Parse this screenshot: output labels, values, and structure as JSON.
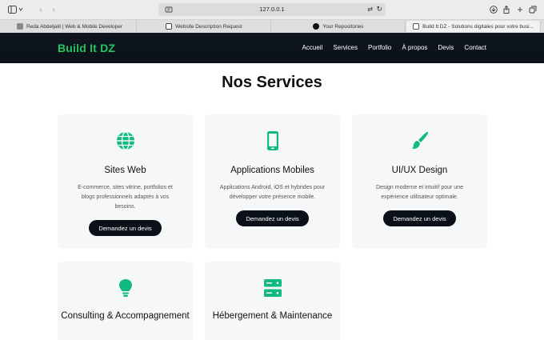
{
  "browser": {
    "url": "127.0.0.1",
    "tabs": [
      {
        "label": "Reda Abdeljalil | Web & Mobile Developer",
        "favicon_color": "#8a8a8a"
      },
      {
        "label": "Website Description Request",
        "favicon_color": "#444444"
      },
      {
        "label": "Your Repositories",
        "favicon_color": "#111111"
      },
      {
        "label": "Build It DZ - Solutions digitales pour votre busi...",
        "favicon_color": "#555555"
      }
    ]
  },
  "site": {
    "logo": "Build It DZ",
    "nav": [
      "Accueil",
      "Services",
      "Portfolio",
      "À propos",
      "Devis",
      "Contact"
    ]
  },
  "section": {
    "title": "Nos Services"
  },
  "services": [
    {
      "icon": "globe-icon",
      "title": "Sites Web",
      "desc": "E-commerce, sites vitrine, portfolios et blogs professionnels adaptés à vos besoins.",
      "cta": "Demandez un devis"
    },
    {
      "icon": "mobile-phone-icon",
      "title": "Applications Mobiles",
      "desc": "Applications Android, iOS et hybrides pour développer votre présence mobile.",
      "cta": "Demandez un devis"
    },
    {
      "icon": "paintbrush-icon",
      "title": "UI/UX Design",
      "desc": "Design moderne et intuitif pour une expérience utilisateur optimale.",
      "cta": "Demandez un devis"
    },
    {
      "icon": "lightbulb-icon",
      "title": "Consulting & Accompagnement"
    },
    {
      "icon": "server-icon",
      "title": "Hébergement & Maintenance"
    }
  ],
  "colors": {
    "accent": "#10b981",
    "logo": "#22c55e",
    "header_bg": "#0b1118",
    "card_bg": "#f6f7f9"
  }
}
